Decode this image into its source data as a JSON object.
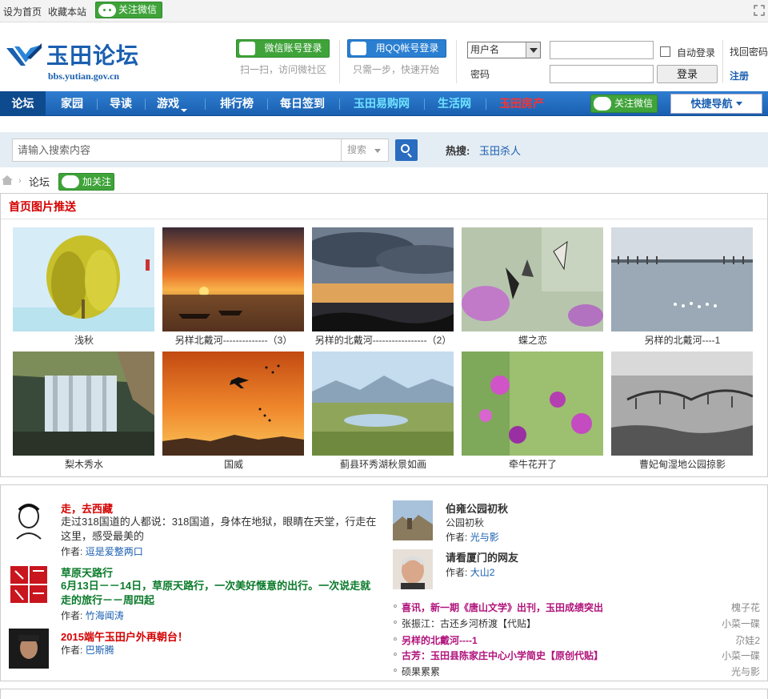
{
  "topbar": {
    "set_home": "设为首页",
    "bookmark": "收藏本站",
    "follow_wechat": "关注微信"
  },
  "header": {
    "site_name": "玉田论坛",
    "site_url": "bbs.yutian.gov.cn",
    "wechat_login": "微信账号登录",
    "wechat_sub": "扫一扫，访问微社区",
    "qq_login": "用QQ帐号登录",
    "qq_sub": "只需一步，快速开始",
    "username_select": "用户名",
    "password_label": "密码",
    "auto_login": "自动登录",
    "login_button": "登录",
    "forgot_password": "找回密码",
    "register": "注册"
  },
  "nav": {
    "items": [
      "论坛",
      "家园",
      "导读",
      "游戏",
      "排行榜",
      "每日签到",
      "玉田易购网",
      "生活网",
      "玉田房产"
    ],
    "follow_wechat": "关注微信",
    "quick_nav": "快捷导航"
  },
  "search": {
    "placeholder": "请输入搜索内容",
    "type": "搜索",
    "hot_label": "热搜:",
    "hot_link": "玉田杀人"
  },
  "breadcrumb": {
    "current": "论坛",
    "add_follow": "加关注"
  },
  "pictures": {
    "title": "首页图片推送",
    "items": [
      {
        "caption": "浅秋",
        "icon": "willow-tree-photo"
      },
      {
        "caption": "另样北戴河--------------（3）",
        "icon": "sunset-boats-photo"
      },
      {
        "caption": "另样的北戴河-----------------（2）",
        "icon": "cloudy-sea-photo"
      },
      {
        "caption": "蝶之恋",
        "icon": "butterfly-photo"
      },
      {
        "caption": "另样的北戴河----1",
        "icon": "sea-birds-photo"
      },
      {
        "caption": "梨木秀水",
        "icon": "waterfall-photo"
      },
      {
        "caption": "国威",
        "icon": "jet-sunset-photo"
      },
      {
        "caption": "蓟县环秀湖秋景如画",
        "icon": "lake-mountain-photo"
      },
      {
        "caption": "牵牛花开了",
        "icon": "morning-glory-photo"
      },
      {
        "caption": "曹妃甸湿地公园掠影",
        "icon": "wetland-bridge-photo"
      }
    ]
  },
  "posts": {
    "left": [
      {
        "title": "走，去西藏",
        "desc": "走过318国道的人都说：318国道，身体在地狱，眼睛在天堂，行走在这里，感受最美的",
        "author_label": "作者:",
        "author": "逗是爱整两口"
      },
      {
        "title": "草原天路行",
        "desc": "6月13日－－14日，草原天路行，一次美好惬意的出行。一次说走就走的旅行－－周四起",
        "author_label": "作者:",
        "author": "竹海闻涛"
      },
      {
        "title": "2015端午玉田户外再朝台！",
        "desc": "",
        "author_label": "作者:",
        "author": "巴斯腾"
      }
    ],
    "right": [
      {
        "title": "伯雍公园初秋",
        "sub": "公园初秋",
        "author_label": "作者:",
        "author": "光与影"
      },
      {
        "title": "请看厦门的网友",
        "sub": "",
        "author_label": "作者:",
        "author": "大山2"
      }
    ],
    "list": [
      {
        "title": "喜讯，新一期《唐山文学》出刊，玉田成绩突出",
        "author": "槐子花",
        "highlight": true
      },
      {
        "title": "张振江：古还乡河桥渡【代贴】",
        "author": "小菜一碟",
        "highlight": false
      },
      {
        "title": "另样的北戴河----1",
        "author": "尕娃2",
        "highlight": true
      },
      {
        "title": "古芳：玉田县陈家庄中心小学简史【原创代贴】",
        "author": "小菜一碟",
        "highlight": true
      },
      {
        "title": "硕果累累",
        "author": "光与影",
        "highlight": false
      }
    ]
  },
  "colors": {
    "nav_blue": "#1a5fb0",
    "wechat_green": "#3fa33a",
    "accent_red": "#d40000",
    "link_blue": "#1a5fb0",
    "nav_highlight_cyan": "#6fe3ff",
    "nav_highlight_red": "#ff3030"
  }
}
